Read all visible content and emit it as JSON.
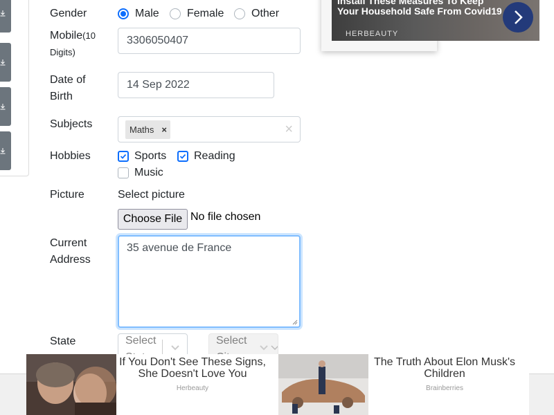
{
  "form": {
    "gender": {
      "label": "Gender",
      "options": [
        {
          "label": "Male",
          "checked": true
        },
        {
          "label": "Female",
          "checked": false
        },
        {
          "label": "Other",
          "checked": false
        }
      ]
    },
    "mobile": {
      "label": "Mobile",
      "note": "(10 Digits)",
      "value": "3306050407"
    },
    "dob": {
      "label": "Date of Birth",
      "value": "14 Sep 2022"
    },
    "subjects": {
      "label": "Subjects",
      "chips": [
        "Maths"
      ],
      "chip_remove": "×",
      "clear": "×"
    },
    "hobbies": {
      "label": "Hobbies",
      "options": [
        {
          "label": "Sports",
          "checked": true
        },
        {
          "label": "Reading",
          "checked": true
        },
        {
          "label": "Music",
          "checked": false
        }
      ]
    },
    "picture": {
      "label": "Picture",
      "select_label": "Select picture",
      "button": "Choose File",
      "status": "No file chosen"
    },
    "address": {
      "label": "Current Address",
      "value": "35 avenue de France"
    },
    "state": {
      "label": "State",
      "state_placeholder": "Select State",
      "city_placeholder": "Select City"
    }
  },
  "ads": {
    "top": {
      "title": "Install These Measures To Keep Your Household Safe From Covid19",
      "source": "HERBEAUTY"
    },
    "bottom": [
      {
        "title": "If You Don't See These Signs, She Doesn't Love You",
        "source": "Herbeauty"
      },
      {
        "title": "The Truth About Elon Musk's Children",
        "source": "Brainberries"
      }
    ]
  },
  "colors": {
    "accent": "#0d6efd",
    "sidebar_button": "#6c757d",
    "ad_button": "#233a7a"
  },
  "icons": [
    "download-icon",
    "chevron-right-icon",
    "chevron-down-icon",
    "check-icon",
    "close-icon"
  ]
}
